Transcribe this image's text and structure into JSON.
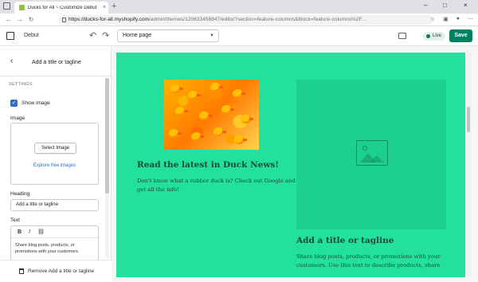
{
  "browser": {
    "tab_title": "Ducks for All ~ Customize Debut",
    "tab_close": "×",
    "new_tab": "+",
    "url_host": "https://ducks-for-all.myshopify.com",
    "url_path": "/admin/themes/120633458847/editor?section=feature-columns&block=feature-columns%2F...",
    "window_controls": [
      "–",
      "□",
      "×"
    ]
  },
  "editor": {
    "theme_name": "Debut",
    "page_select": "Home page",
    "status": "Live",
    "save_label": "Save"
  },
  "sidebar": {
    "title": "Add a title or tagline",
    "section_label": "SETTINGS",
    "show_image_label": "Show image",
    "show_image_checked": true,
    "image_label": "Image",
    "select_image_button": "Select Image",
    "explore_link": "Explore free images",
    "heading_label": "Heading",
    "heading_value": "Add a title or tagline",
    "text_label": "Text",
    "rte_bold": "B",
    "rte_italic": "I",
    "rte_text": "Share blog posts, products, or promotions with your customers.",
    "remove_label": "Remove Add a title or tagline"
  },
  "preview": {
    "col1_heading": "Read the latest in Duck News!",
    "col1_text": "Don't know what a rubber duck is? Check out Google and get all the info!",
    "col2_heading": "Add a title or tagline",
    "col2_text": "Share blog posts, products, or promotions with your customers. Use this text to describe products, share"
  },
  "colors": {
    "accent": "#008060",
    "preview_bg": "#24e09d",
    "placeholder_bg": "#1ed08f",
    "preview_text": "#174a3a",
    "link": "#2c6ecb"
  }
}
